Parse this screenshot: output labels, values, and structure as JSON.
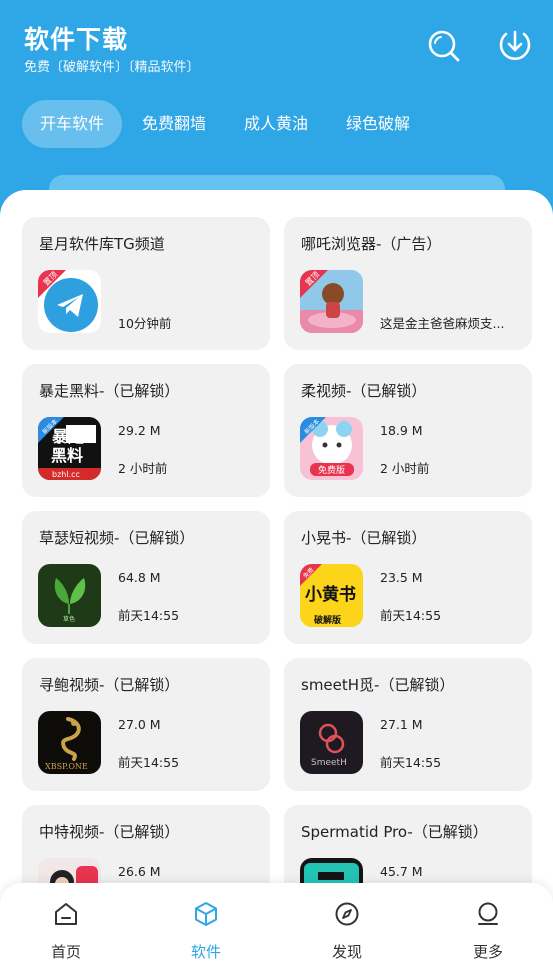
{
  "header": {
    "title": "软件下载",
    "subtitle": "免费〔破解软件〕〔精品软件〕",
    "icons": [
      "search-icon",
      "download-icon"
    ]
  },
  "tabs": [
    "开车软件",
    "免费翻墙",
    "成人黄油",
    "绿色破解"
  ],
  "active_tab": "开车软件",
  "cards": [
    {
      "title": "星月软件库TG频道",
      "meta1": "",
      "meta2": "10分钟前",
      "icon": "telegram-icon",
      "badge": "置顶"
    },
    {
      "title": "哪吒浏览器-（广告）",
      "meta1": "",
      "meta2": "这是金主爸爸麻烦支...",
      "icon": "nezha-icon",
      "badge": "置顶"
    },
    {
      "title": "暴走黑料-（已解锁）",
      "meta1": "29.2 M",
      "meta2": "2 小时前",
      "icon": "baozou-icon",
      "icon_text1": "暴走",
      "icon_text2": "黑料",
      "icon_text3": "bzhl.cc",
      "badge": "新版本"
    },
    {
      "title": "柔视频-（已解锁）",
      "meta1": "18.9 M",
      "meta2": "2 小时前",
      "icon": "rou-icon",
      "icon_text1": "免费版",
      "badge": "新版本"
    },
    {
      "title": "草瑟短视频-（已解锁）",
      "meta1": "64.8 M",
      "meta2": "前天14:55",
      "icon": "leaf-icon",
      "icon_text1": "草色"
    },
    {
      "title": "小晃书-（已解锁）",
      "meta1": "23.5 M",
      "meta2": "前天14:55",
      "icon": "xiaohuangshu-icon",
      "icon_text1": "小黄书",
      "icon_text2": "破解版",
      "badge": "免费"
    },
    {
      "title": "寻鲍视频-（已解锁）",
      "meta1": "27.0 M",
      "meta2": "前天14:55",
      "icon": "dragon-icon",
      "icon_text1": "XBSP.ONE"
    },
    {
      "title": "smeetH觅-（已解锁）",
      "meta1": "27.1 M",
      "meta2": "前天14:55",
      "icon": "smeeth-icon",
      "icon_text1": "SmeetH"
    },
    {
      "title": "中特视频-（已解锁）",
      "meta1": "26.6 M",
      "meta2": "",
      "icon": "zhongte-icon"
    },
    {
      "title": "Spermatid Pro-（已解锁）",
      "meta1": "45.7 M",
      "meta2": "",
      "icon": "tv-icon"
    }
  ],
  "nav": [
    {
      "label": "首页",
      "icon": "home-icon"
    },
    {
      "label": "软件",
      "icon": "box-icon"
    },
    {
      "label": "发现",
      "icon": "compass-icon"
    },
    {
      "label": "更多",
      "icon": "profile-icon"
    }
  ],
  "active_nav": "软件",
  "colors": {
    "primary": "#2fa6e6",
    "card_bg": "#f1f1f1",
    "badge_red": "#e8344e"
  }
}
